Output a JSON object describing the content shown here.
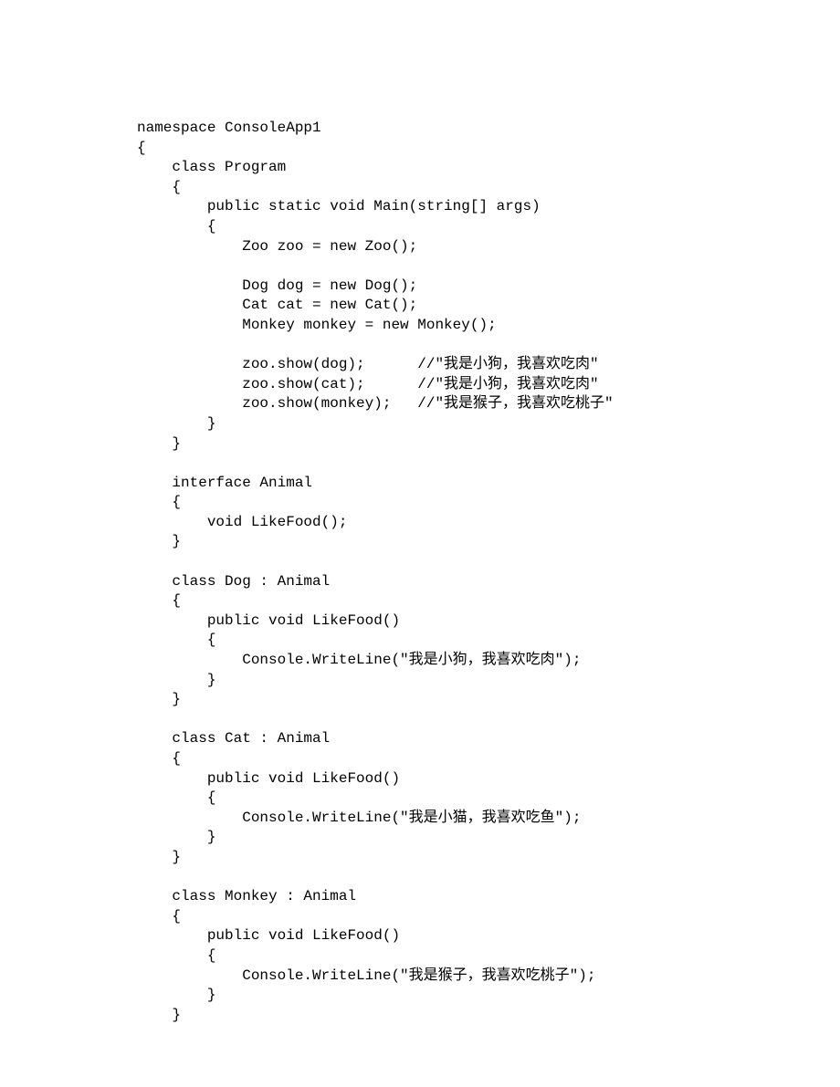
{
  "code": {
    "lines": [
      "namespace ConsoleApp1",
      "{",
      "    class Program",
      "    {",
      "        public static void Main(string[] args)",
      "        {",
      "            Zoo zoo = new Zoo();",
      "",
      "            Dog dog = new Dog();",
      "            Cat cat = new Cat();",
      "            Monkey monkey = new Monkey();",
      "",
      "            zoo.show(dog);      //\"我是小狗，我喜欢吃肉\"",
      "            zoo.show(cat);      //\"我是小狗，我喜欢吃肉\"",
      "            zoo.show(monkey);   //\"我是猴子，我喜欢吃桃子\"",
      "        }",
      "    }",
      "",
      "    interface Animal",
      "    {",
      "        void LikeFood();",
      "    }",
      "",
      "    class Dog : Animal",
      "    {",
      "        public void LikeFood()",
      "        {",
      "            Console.WriteLine(\"我是小狗，我喜欢吃肉\");",
      "        }",
      "    }",
      "",
      "    class Cat : Animal",
      "    {",
      "        public void LikeFood()",
      "        {",
      "            Console.WriteLine(\"我是小猫，我喜欢吃鱼\");",
      "        }",
      "    }",
      "",
      "    class Monkey : Animal",
      "    {",
      "        public void LikeFood()",
      "        {",
      "            Console.WriteLine(\"我是猴子，我喜欢吃桃子\");",
      "        }",
      "    }"
    ]
  }
}
